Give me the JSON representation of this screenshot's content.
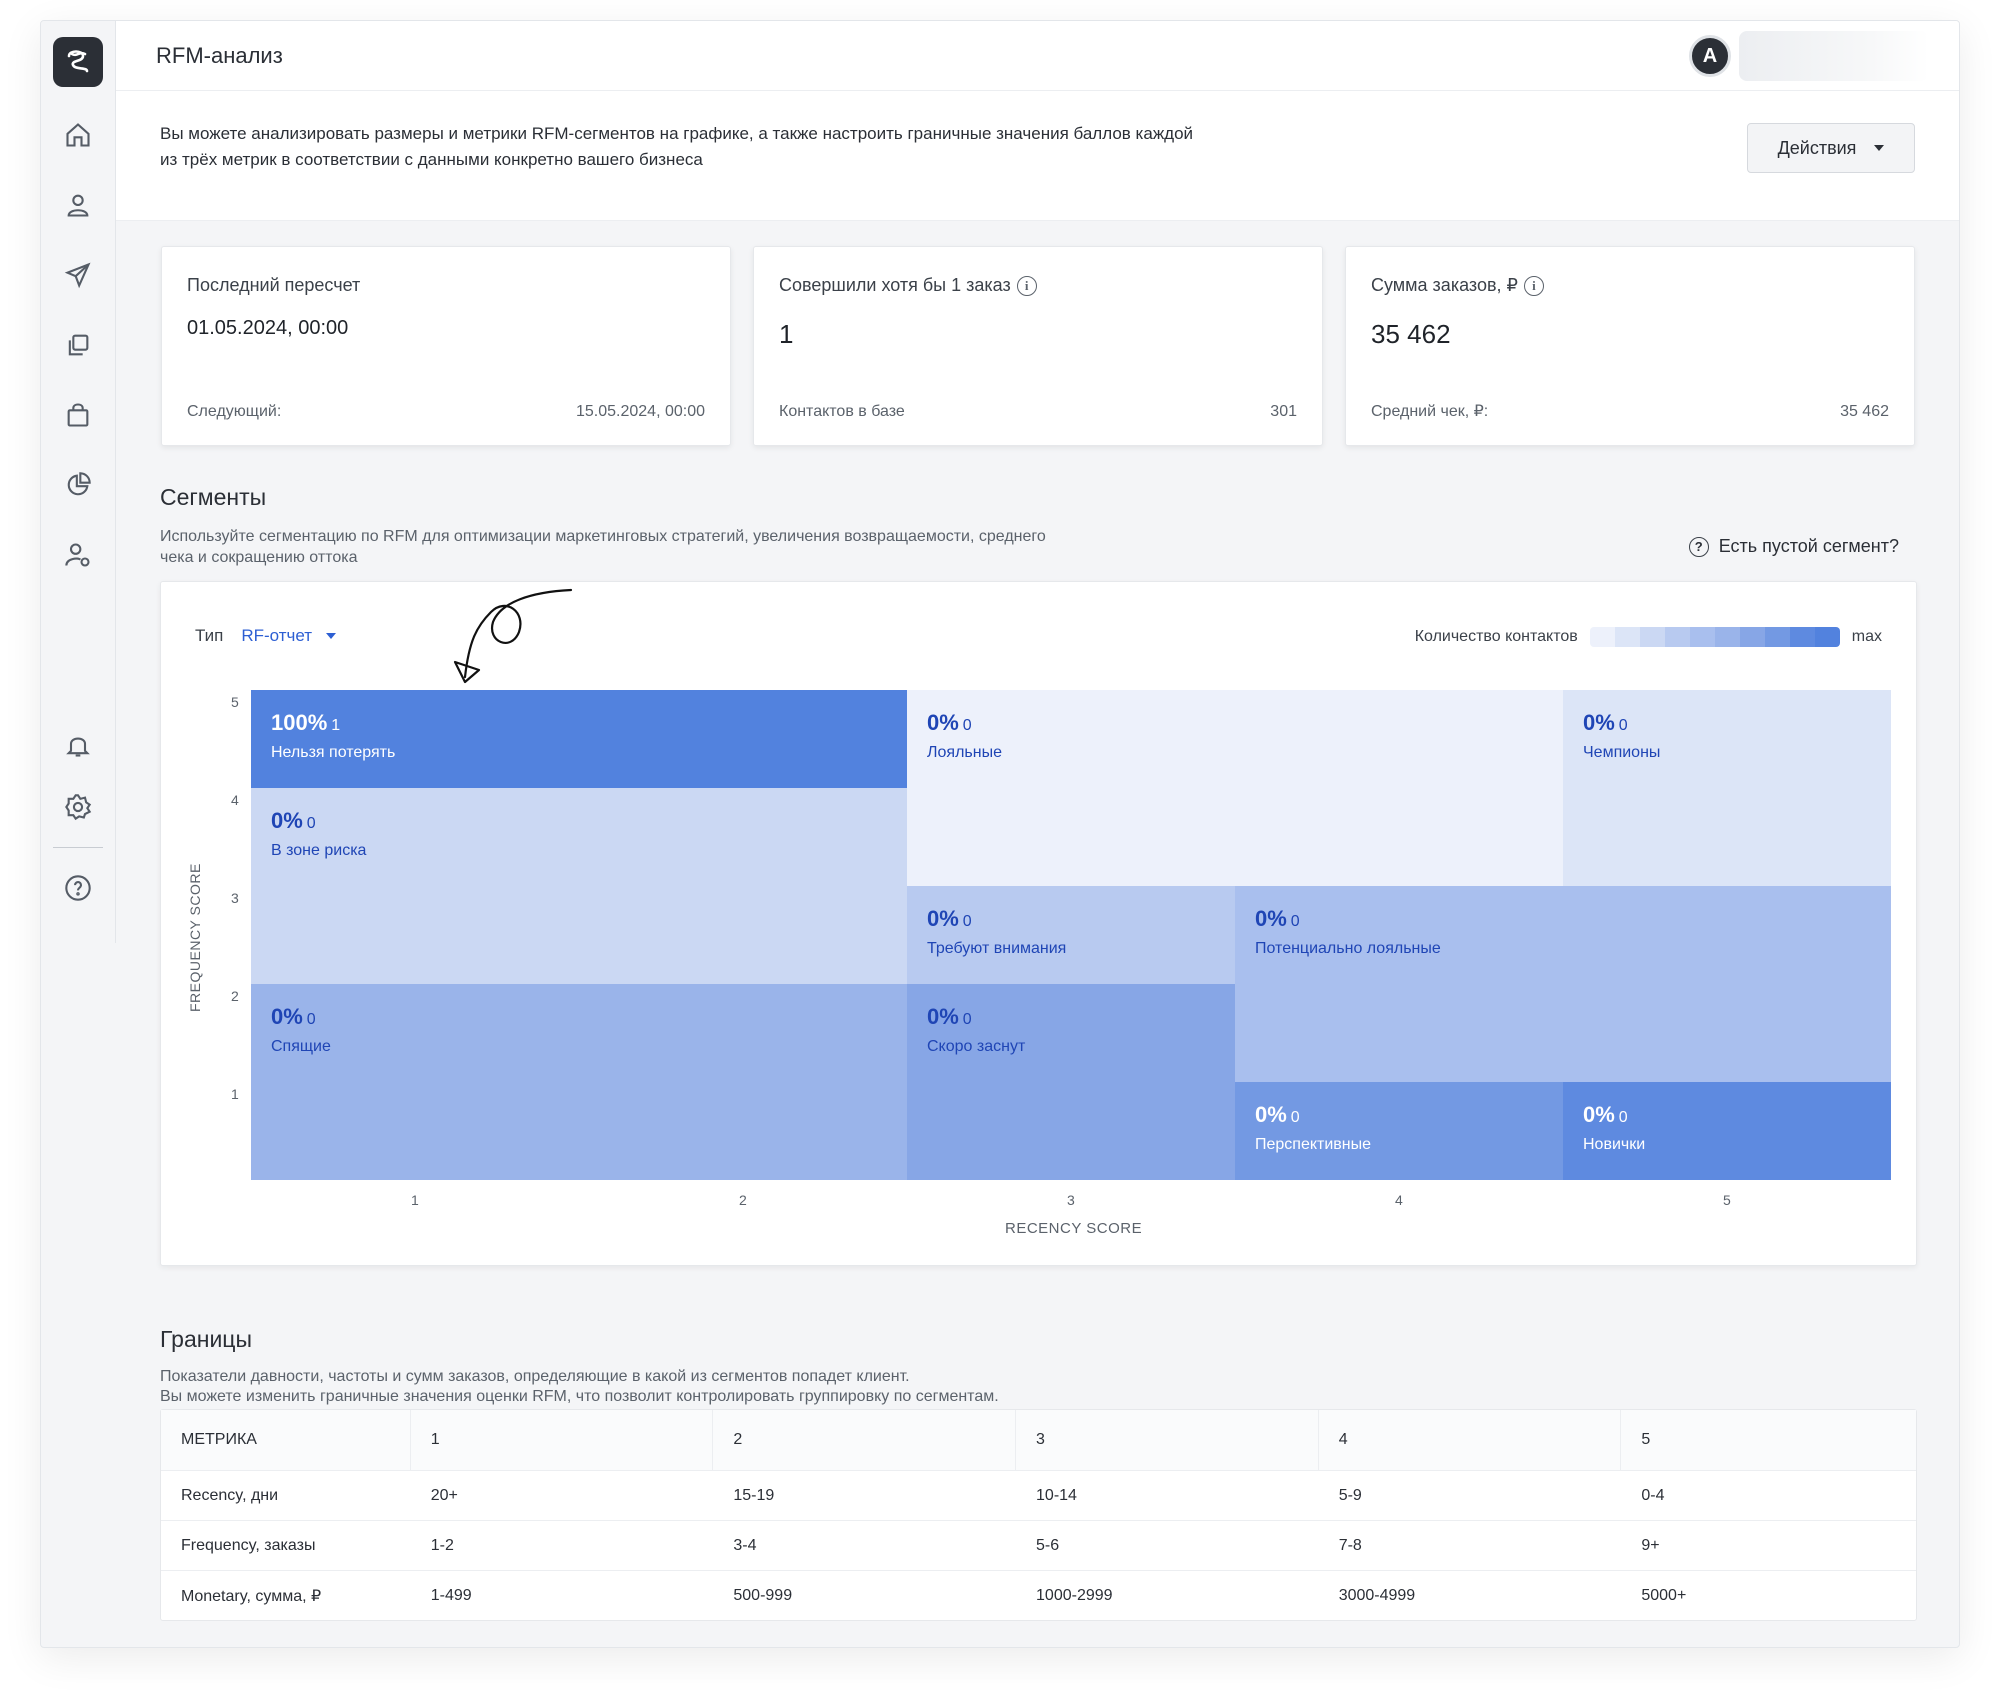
{
  "header": {
    "title": "RFM-анализ",
    "avatar_letter": "A"
  },
  "sidebar": {
    "items": [
      {
        "icon": "home-icon"
      },
      {
        "icon": "user-icon"
      },
      {
        "icon": "send-icon"
      },
      {
        "icon": "copy-icon"
      },
      {
        "icon": "bag-icon"
      },
      {
        "icon": "pie-chart-icon"
      },
      {
        "icon": "user-settings-icon"
      },
      {
        "icon": "bell-icon"
      },
      {
        "icon": "gear-icon"
      },
      {
        "icon": "help-icon"
      }
    ]
  },
  "intro": {
    "text": "Вы можете анализировать размеры и метрики RFM-сегментов на графике, а также настроить граничные значения баллов каждой из трёх метрик в соответствии с данными конкретно вашего бизнеса",
    "actions_label": "Действия"
  },
  "cards": [
    {
      "label": "Последний пересчет",
      "value": "01.05.2024, 00:00",
      "foot_label": "Следующий:",
      "foot_value": "15.05.2024, 00:00"
    },
    {
      "label": "Совершили хотя бы 1 заказ",
      "value": "1",
      "foot_label": "Контактов в базе",
      "foot_value": "301"
    },
    {
      "label": "Сумма заказов, ₽",
      "value": "35 462",
      "foot_label": "Средний чек, ₽:",
      "foot_value": "35 462"
    }
  ],
  "segments": {
    "title": "Сегменты",
    "description": "Используйте сегментацию по RFM для оптимизации маркетинговых стратегий, увеличения возвращаемости, среднего чека и сокращению оттока",
    "empty_question": "Есть пустой сегмент?",
    "type_label": "Тип",
    "type_value": "RF-отчет",
    "legend_label": "Количество контактов",
    "legend_max": "max",
    "y_axis_title": "FREQUENCY SCORE",
    "x_axis_title": "RECENCY SCORE",
    "y_ticks": [
      "5",
      "4",
      "3",
      "2",
      "1"
    ],
    "x_ticks": [
      "1",
      "2",
      "3",
      "4",
      "5"
    ],
    "cells": [
      {
        "pct": "100%",
        "count": "1",
        "name": "Нельзя потерять",
        "color": "#5282de",
        "dark": true
      },
      {
        "pct": "0%",
        "count": "0",
        "name": "Лояльные",
        "color": "#edf1fb",
        "dark": false
      },
      {
        "pct": "0%",
        "count": "0",
        "name": "Чемпионы",
        "color": "#dce5f7",
        "dark": false
      },
      {
        "pct": "0%",
        "count": "0",
        "name": "В зоне риска",
        "color": "#cbd8f3",
        "dark": false
      },
      {
        "pct": "0%",
        "count": "0",
        "name": "Требуют внимания",
        "color": "#b8caf0",
        "dark": false
      },
      {
        "pct": "0%",
        "count": "0",
        "name": "Потенциально лояльные",
        "color": "#a9bfee",
        "dark": false
      },
      {
        "pct": "0%",
        "count": "0",
        "name": "Спящие",
        "color": "#9ab4ea",
        "dark": false
      },
      {
        "pct": "0%",
        "count": "0",
        "name": "Скоро заснут",
        "color": "#87a6e6",
        "dark": false
      },
      {
        "pct": "0%",
        "count": "0",
        "name": "Перспективные",
        "color": "#7399e3",
        "dark": true
      },
      {
        "pct": "0%",
        "count": "0",
        "name": "Новички",
        "color": "#5e8ae0",
        "dark": true
      }
    ]
  },
  "bounds": {
    "title": "Границы",
    "description_1": "Показатели давности, частоты и сумм заказов, определяющие в какой из сегментов попадет клиент.",
    "description_2": "Вы можете изменить граничные значения оценки RFM, что позволит контролировать группировку по сегментам.",
    "headers": [
      "МЕТРИКА",
      "1",
      "2",
      "3",
      "4",
      "5"
    ],
    "rows": [
      [
        "Recency, дни",
        "20+",
        "15-19",
        "10-14",
        "5-9",
        "0-4"
      ],
      [
        "Frequency, заказы",
        "1-2",
        "3-4",
        "5-6",
        "7-8",
        "9+"
      ],
      [
        "Monetary, сумма, ₽",
        "1-499",
        "500-999",
        "1000-2999",
        "3000-4999",
        "5000+"
      ]
    ]
  },
  "colors": {
    "accent": "#2d5fd3",
    "legend_scale": [
      "#edf1fb",
      "#dce5f7",
      "#cbd8f3",
      "#b8caf0",
      "#a9bfee",
      "#9ab4ea",
      "#87a6e6",
      "#7399e3",
      "#5e8ae0",
      "#5282de"
    ]
  }
}
